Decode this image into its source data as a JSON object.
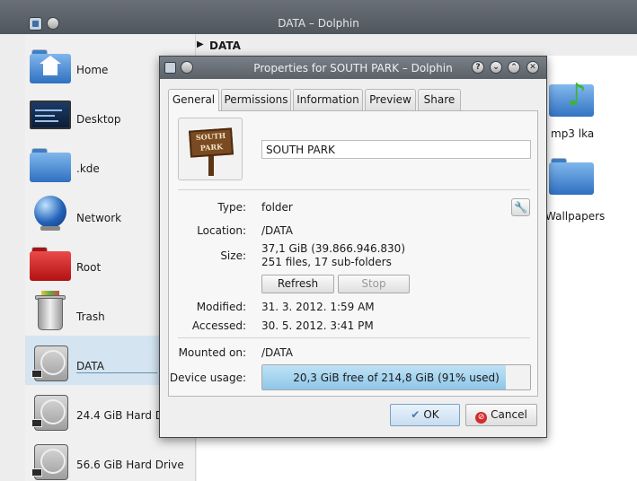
{
  "main_window": {
    "title": "DATA – Dolphin",
    "breadcrumb": "DATA",
    "places": [
      {
        "label": "Home",
        "icon": "home-folder-icon"
      },
      {
        "label": "Desktop",
        "icon": "desktop-icon"
      },
      {
        "label": ".kde",
        "icon": "folder-icon"
      },
      {
        "label": "Network",
        "icon": "network-globe-icon"
      },
      {
        "label": "Root",
        "icon": "red-folder-icon"
      },
      {
        "label": "Trash",
        "icon": "trash-icon"
      },
      {
        "label": "DATA",
        "icon": "hard-drive-icon",
        "active": true
      },
      {
        "label": "24.4 GiB Hard Drive",
        "icon": "hard-drive-icon"
      },
      {
        "label": "56.6 GiB Hard Drive",
        "icon": "hard-drive-icon"
      }
    ],
    "files": [
      {
        "label": "mp3 lka",
        "icon": "music-folder-icon"
      },
      {
        "label": "Wallpapers",
        "icon": "folder-icon"
      }
    ]
  },
  "dialog": {
    "title": "Properties for SOUTH PARK – Dolphin",
    "tabs": [
      "General",
      "Permissions",
      "Information",
      "Preview",
      "Share"
    ],
    "active_tab": "General",
    "preview_sign": [
      "SOUTH",
      "PARK"
    ],
    "name": "SOUTH PARK",
    "fields": {
      "type_label": "Type:",
      "type_value": "folder",
      "location_label": "Location:",
      "location_value": "/DATA",
      "size_label": "Size:",
      "size_value": "37,1 GiB (39.866.946.830)",
      "size_detail": "251 files, 17 sub-folders",
      "modified_label": "Modified:",
      "modified_value": "31. 3. 2012. 1:59 AM",
      "accessed_label": "Accessed:",
      "accessed_value": "30. 5. 2012. 3:41 PM",
      "mounted_label": "Mounted on:",
      "mounted_value": "/DATA",
      "usage_label": "Device usage:",
      "usage_text": "20,3 GiB free of 214,8 GiB (91% used)",
      "usage_fraction": 0.91
    },
    "buttons": {
      "refresh": "Refresh",
      "stop": "Stop",
      "ok": "OK",
      "cancel": "Cancel"
    },
    "window_buttons": [
      "?",
      "⌄",
      "⌃",
      "✕"
    ]
  },
  "colors": {
    "selection": "#d4e5f1",
    "usage_fill": "#8fc6e8",
    "folder_blue": "#2f70c0"
  }
}
